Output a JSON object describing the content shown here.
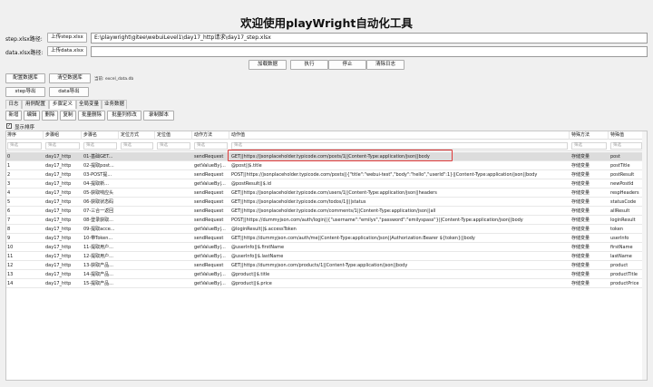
{
  "title": "欢迎使用playWright自动化工具",
  "step_row": {
    "label": "step.xlsx路径:",
    "upload": "上传step.xlsx",
    "path": "E:\\playwright\\gitee\\webuiLevel1\\day17_http请求\\day17_step.xlsx"
  },
  "data_row": {
    "label": "data.xlsx路径:",
    "upload": "上传data.xlsx",
    "path": ""
  },
  "actions": {
    "load": "加载数据",
    "run": "执行",
    "stop": "停止",
    "clear_log": "清除日志"
  },
  "config": {
    "db_config": "配置数据库",
    "clear_db": "清空数据库",
    "current_db": "当前: excel_data.db"
  },
  "export_tabs": {
    "step": "step导出",
    "data": "data导出"
  },
  "main_tabs": [
    "日志",
    "用例配置",
    "步骤定义",
    "全局变量",
    "业务数据"
  ],
  "toolbar": [
    "新增",
    "编辑",
    "删除",
    "复制",
    "批量删除",
    "批量列修改",
    "录制脚本"
  ],
  "show_order": "显示排序",
  "filter_placeholder": "筛选",
  "columns": [
    "排序",
    "步骤组",
    "步骤名",
    "定位方式",
    "定位值",
    "动作方法",
    "动作值",
    "特殊方法",
    "特殊值"
  ],
  "rows": [
    [
      "0",
      "day17_http",
      "01-基础GET...",
      "",
      "",
      "sendRequest",
      "GET||https://jsonplaceholder.typicode.com/posts/1||Content-Type:application/json||body",
      "存储变量",
      "post"
    ],
    [
      "1",
      "day17_http",
      "02-提取post...",
      "",
      "",
      "getValueBy|...",
      "@post||$.title",
      "存储变量",
      "postTitle"
    ],
    [
      "2",
      "day17_http",
      "03-POST提...",
      "",
      "",
      "sendRequest",
      "POST||https://jsonplaceholder.typicode.com/posts||{\"title\":\"webui-test\",\"body\":\"hello\",\"userId\":1}||Content-Type:application/json||body",
      "存储变量",
      "postResult"
    ],
    [
      "3",
      "day17_http",
      "04-提取新...",
      "",
      "",
      "getValueBy|...",
      "@postResult||$.id",
      "存储变量",
      "newPostId"
    ],
    [
      "4",
      "day17_http",
      "05-获取响应头",
      "",
      "",
      "sendRequest",
      "GET||https://jsonplaceholder.typicode.com/users/1||Content-Type:application/json||headers",
      "存储变量",
      "respHeaders"
    ],
    [
      "5",
      "day17_http",
      "06-获取状态码",
      "",
      "",
      "sendRequest",
      "GET||https://jsonplaceholder.typicode.com/todos/1||||status",
      "存储变量",
      "statusCode"
    ],
    [
      "6",
      "day17_http",
      "07-三合一返回",
      "",
      "",
      "sendRequest",
      "GET||https://jsonplaceholder.typicode.com/comments/1||Content-Type:application/json||all",
      "存储变量",
      "allResult"
    ],
    [
      "7",
      "day17_http",
      "08-登录获取...",
      "",
      "",
      "sendRequest",
      "POST||https://dummyjson.com/auth/login||{\"username\":\"emilys\",\"password\":\"emilyspass\"}||Content-Type:application/json||body",
      "存储变量",
      "loginResult"
    ],
    [
      "8",
      "day17_http",
      "09-提取acce...",
      "",
      "",
      "getValueBy|...",
      "@loginResult||$.accessToken",
      "存储变量",
      "token"
    ],
    [
      "9",
      "day17_http",
      "10-带Token...",
      "",
      "",
      "sendRequest",
      "GET||https://dummyjson.com/auth/me||Content-Type:application/json||Authorization:Bearer ${token}||body",
      "存储变量",
      "userInfo"
    ],
    [
      "10",
      "day17_http",
      "11-提取用户...",
      "",
      "",
      "getValueBy|...",
      "@userInfo||$.firstName",
      "存储变量",
      "firstName"
    ],
    [
      "11",
      "day17_http",
      "12-提取用户...",
      "",
      "",
      "getValueBy|...",
      "@userInfo||$.lastName",
      "存储变量",
      "lastName"
    ],
    [
      "12",
      "day17_http",
      "13-获取产品...",
      "",
      "",
      "sendRequest",
      "GET||https://dummyjson.com/products/1||Content-Type:application/json||body",
      "存储变量",
      "product"
    ],
    [
      "13",
      "day17_http",
      "14-提取产品...",
      "",
      "",
      "getValueBy|...",
      "@product||$.title",
      "存储变量",
      "productTitle"
    ],
    [
      "14",
      "day17_http",
      "15-提取产品...",
      "",
      "",
      "getValueBy|...",
      "@product||$.price",
      "存储变量",
      "productPrice"
    ]
  ],
  "highlight_color": "#e03a3a"
}
